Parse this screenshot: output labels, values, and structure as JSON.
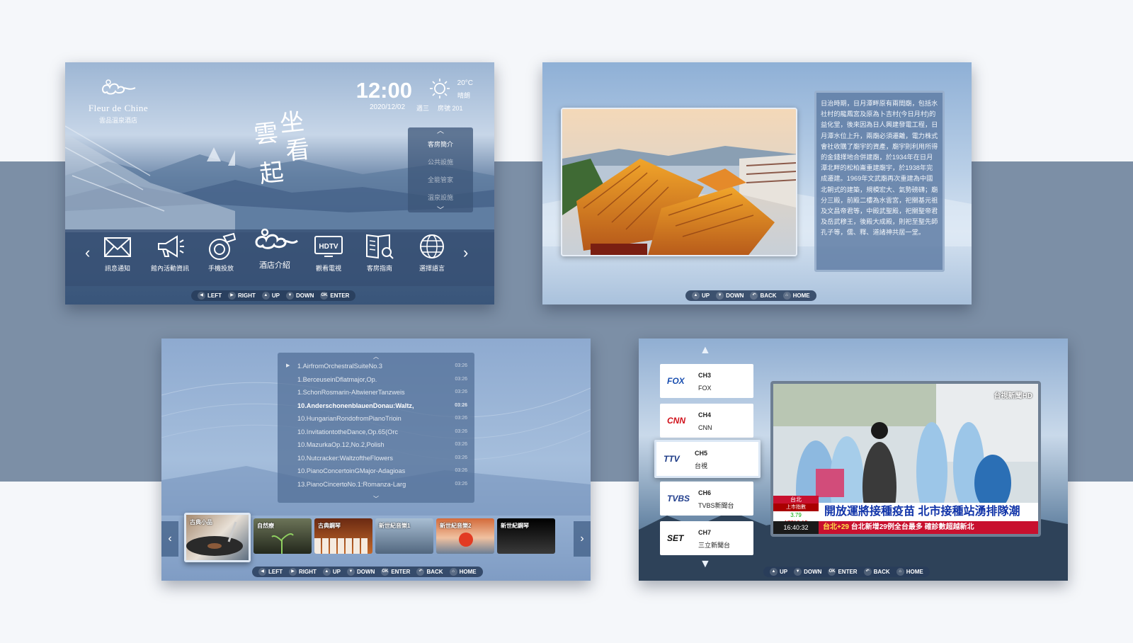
{
  "screen1": {
    "brand": "Fleur de Chine",
    "brand_sub": "雲品溫泉酒店",
    "time": "12:00",
    "temperature": "20°C",
    "weather": "晴朗",
    "date": "2020/12/02",
    "weekday": "週三",
    "room": "房號 201",
    "calligraphy": [
      "坐",
      "看",
      "雲",
      "起"
    ],
    "submenu": [
      "客房簡介",
      "公共設施",
      "全能管家",
      "溫泉設施"
    ],
    "nav": [
      {
        "label": "訊息通知",
        "icon": "envelope-icon"
      },
      {
        "label": "館內活動資訊",
        "icon": "megaphone-icon"
      },
      {
        "label": "手機投放",
        "icon": "cast-icon"
      },
      {
        "label": "酒店介紹",
        "icon": "cloud-logo-icon"
      },
      {
        "label": "觀看電視",
        "icon": "hdtv-icon"
      },
      {
        "label": "客房指南",
        "icon": "guide-book-icon"
      },
      {
        "label": "選擇語言",
        "icon": "globe-icon"
      }
    ],
    "keys": [
      "LEFT",
      "RIGHT",
      "UP",
      "DOWN",
      "ENTER"
    ]
  },
  "screen2": {
    "text": "日治時期，日月潭畔原有兩間廟，包括水社村的龍鳳宮及原為卜吉村(今日月村)的益化堂，後來因為日人興建發電工程，日月潭水位上升，兩廟必須遷離，電力株式會社收購了廟宇的資產，廟宇則利用所得的金錢擇地合併建廟，於1934年在日月潭北畔的松柏崙重建廟宇，於1938年完成遷建。1969年文武廟再次重建為中國北朝式的建築，規模宏大、氣勢磅礴；廟分三殿，前殿二樓為水雲宮，祀關基元祖及文昌帝君等，中殿武聖殿，祀關聖帝君及岳武穆王，後殿大成殿，則祀至聖先師孔子等，儒、釋、道諸神共居一堂。",
    "keys": [
      "UP",
      "DOWN",
      "BACK",
      "HOME"
    ]
  },
  "screen3": {
    "tracks": [
      {
        "title": "1.AirfromOrchestralSuiteNo.3",
        "duration": "03:26"
      },
      {
        "title": "1.BerceuseinDflatmajor,Op.",
        "duration": "03:26"
      },
      {
        "title": "1.SchonRosmarin-AltwienerTanzweis",
        "duration": "03:26"
      },
      {
        "title": "10.AnderschonenblauenDonau:Waltz,",
        "duration": "03:26"
      },
      {
        "title": "10.HungarianRondofromPianoTrioin",
        "duration": "03:26"
      },
      {
        "title": "10.InvitationtotheDance,Op.65(Orc",
        "duration": "03:26"
      },
      {
        "title": "10.MazurkaOp.12,No.2,Polish",
        "duration": "03:26"
      },
      {
        "title": "10.Nutcracker:WaltzoftheFlowers",
        "duration": "03:26"
      },
      {
        "title": "10.PianoConcertoinGMajor-Adagioas",
        "duration": "03:26"
      },
      {
        "title": "13.PianoCincertoNo.1:Romanza-Larg",
        "duration": "03:26"
      }
    ],
    "albums": [
      "古典小品",
      "自然療",
      "古典鋼琴",
      "新世紀音樂1",
      "新世紀音樂2",
      "新世紀鋼琴"
    ],
    "keys": [
      "LEFT",
      "RIGHT",
      "UP",
      "DOWN",
      "ENTER",
      "BACK",
      "HOME"
    ]
  },
  "screen4": {
    "channels": [
      {
        "logo": "FOX",
        "number": "CH3",
        "name": "FOX",
        "color": "#1a4fb0"
      },
      {
        "logo": "CNN",
        "number": "CH4",
        "name": "CNN",
        "color": "#d0101a"
      },
      {
        "logo": "TTV",
        "number": "CH5",
        "name": "台視",
        "color": "#1c3a86"
      },
      {
        "logo": "TVBS",
        "number": "CH6",
        "name": "TVBS新聞台",
        "color": "#23408e"
      },
      {
        "logo": "SET",
        "number": "CH7",
        "name": "三立新聞台",
        "color": "#111111"
      }
    ],
    "broadcast": {
      "station": "台視新聞HD",
      "location": "台北",
      "index_label": "上市指數",
      "index_change": "3.79",
      "index_value": "17710.15",
      "clock": "16:40:32",
      "headline": "開放運將接種疫苗 北市接種站湧排隊潮",
      "ticker_hl": "台北+29",
      "ticker": "台北新增29例全台最多 確診數超越新北"
    },
    "keys": [
      "UP",
      "DOWN",
      "ENTER",
      "BACK",
      "HOME"
    ]
  }
}
